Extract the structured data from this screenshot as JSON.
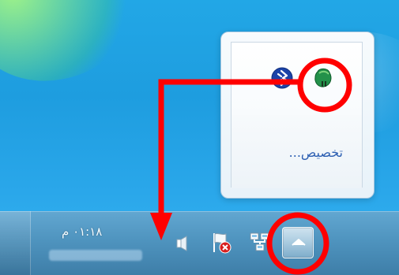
{
  "tray_popup": {
    "customize_label": "تخصيص..."
  },
  "taskbar": {
    "clock_text": "٠١:١٨ م"
  },
  "icons": {
    "bluetooth": "bluetooth-icon",
    "mouse": "mouse-icon",
    "speaker": "speaker-icon",
    "action_center": "action-center-flag-icon",
    "network": "network-icon",
    "show_hidden": "chevron-up-icon"
  },
  "colors": {
    "annotation_red": "#ff0000",
    "taskbar_blue": "#4f94bf",
    "desktop_blue": "#22a7e6",
    "link_blue": "#2d5fb2"
  }
}
